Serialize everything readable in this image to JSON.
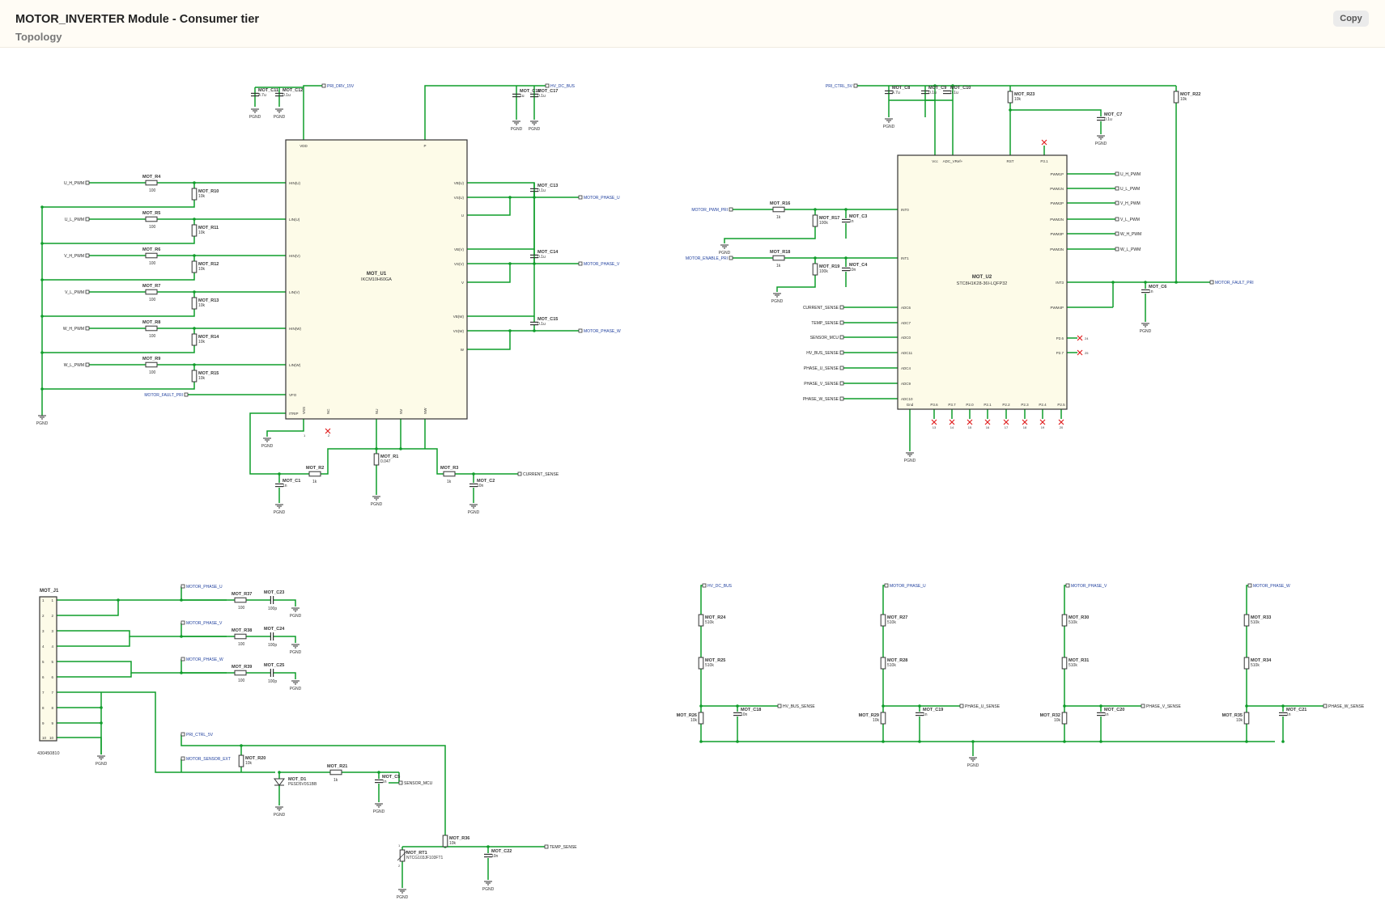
{
  "header": {
    "title": "MOTOR_INVERTER Module - Consumer tier",
    "subtitle": "Topology",
    "copy_label": "Copy"
  },
  "colors": {
    "wire": "#0f9d2a",
    "component": "#333333",
    "ic_fill": "#fdfbe8",
    "net_label": "#1f3f9e",
    "no_connect": "#e02020"
  },
  "gnd_label": "PGND",
  "blocks": {
    "gate_driver": {
      "ic": {
        "ref": "MOT_U1",
        "part": "IKCM10H60GA",
        "left_pins": [
          "HIN(U)",
          "LIN(U)",
          "HIN(V)",
          "LIN(V)",
          "HIN(W)",
          "LIN(W)",
          "VFO",
          "ITRIP"
        ],
        "right_pins": [
          "VB(U)",
          "VS(U)",
          "U",
          "VB(V)",
          "VS(V)",
          "V",
          "VB(W)",
          "VS(W)",
          "W"
        ],
        "top_pins": [
          "VDD",
          "P"
        ],
        "bottom_pins": [
          "VSS",
          "NC",
          "NU",
          "NV",
          "NW"
        ]
      },
      "inputs": [
        {
          "net": "U_H_PWM",
          "r": "MOT_R4",
          "rv": "100",
          "pd": "MOT_R10",
          "pdv": "10k"
        },
        {
          "net": "U_L_PWM",
          "r": "MOT_R5",
          "rv": "100",
          "pd": "MOT_R11",
          "pdv": "10k"
        },
        {
          "net": "V_H_PWM",
          "r": "MOT_R6",
          "rv": "100",
          "pd": "MOT_R12",
          "pdv": "10k"
        },
        {
          "net": "V_L_PWM",
          "r": "MOT_R7",
          "rv": "100",
          "pd": "MOT_R13",
          "pdv": "10k"
        },
        {
          "net": "W_H_PWM",
          "r": "MOT_R8",
          "rv": "100",
          "pd": "MOT_R14",
          "pdv": "10k"
        },
        {
          "net": "W_L_PWM",
          "r": "MOT_R9",
          "rv": "100",
          "pd": "MOT_R15",
          "pdv": "10k"
        }
      ],
      "fault_net": "MOTOR_FAULT_PRI",
      "supply_caps": [
        {
          "ref": "MOT_C11",
          "val": "4.7u"
        },
        {
          "ref": "MOT_C12",
          "val": "0.1u"
        },
        {
          "ref": "MOT_C16",
          "val": "1u"
        },
        {
          "ref": "MOT_C17",
          "val": "0.1u"
        }
      ],
      "supply_nets": [
        "PRI_DRV_15V",
        "HV_DC_BUS"
      ],
      "bootstrap": [
        {
          "ref": "MOT_C13",
          "val": "0.1u",
          "net": "MOTOR_PHASE_U"
        },
        {
          "ref": "MOT_C14",
          "val": "0.1u",
          "net": "MOTOR_PHASE_V"
        },
        {
          "ref": "MOT_C15",
          "val": "0.1u",
          "net": "MOTOR_PHASE_W"
        }
      ],
      "bottom": {
        "c1": {
          "ref": "MOT_C1",
          "val": "1n"
        },
        "r2": {
          "ref": "MOT_R2",
          "val": "1k"
        },
        "r1": {
          "ref": "MOT_R1",
          "val": "0.047"
        },
        "r3": {
          "ref": "MOT_R3",
          "val": "1k"
        },
        "c2": {
          "ref": "MOT_C2",
          "val": "10n"
        },
        "sense_net": "CURRENT_SENSE"
      }
    },
    "mcu": {
      "ic": {
        "ref": "MOT_U2",
        "part": "STC8H1K28-36I-LQFP32",
        "left_pins": [
          "INT0",
          "INT1",
          "ADC6",
          "ADC7",
          "ADC0",
          "ADC11",
          "ADC4",
          "ADC9",
          "ADC10"
        ],
        "right_pins": [
          "PWM1P",
          "PWM1N",
          "PWM2P",
          "PWM2N",
          "PWM3P",
          "PWM3N",
          "INT3",
          "PWM4P",
          "P2.6",
          "P2.7"
        ],
        "top_pins": [
          "Vcc",
          "ADC_VRef+",
          "RST",
          "P3.1"
        ],
        "bottom_pins": [
          "Gnd",
          "P3.6",
          "P3.7",
          "P2.0",
          "P2.1",
          "P2.2",
          "P2.3",
          "P2.4",
          "P2.5"
        ]
      },
      "supply_net": "PRI_CTRL_5V",
      "caps": [
        {
          "ref": "MOT_C8",
          "val": "4.7u"
        },
        {
          "ref": "MOT_C9",
          "val": "0.1u"
        },
        {
          "ref": "MOT_C10",
          "val": "0.1u"
        },
        {
          "ref": "MOT_C7",
          "val": "0.1u"
        }
      ],
      "pullups": [
        {
          "ref": "MOT_R23",
          "val": "10k"
        },
        {
          "ref": "MOT_R22",
          "val": "10k"
        }
      ],
      "pwm_in": {
        "net": "MOTOR_PWM_PRI",
        "r": "MOT_R16",
        "rv": "1k",
        "pd": "MOT_R17",
        "pdv": "100k",
        "c": "MOT_C3",
        "cv": "1n"
      },
      "en_in": {
        "net": "MOTOR_ENABLE_PRI",
        "r": "MOT_R18",
        "rv": "1k",
        "pd": "MOT_R19",
        "pdv": "100k",
        "c": "MOT_C4",
        "cv": "10n"
      },
      "adc_nets": [
        "CURRENT_SENSE",
        "TEMP_SENSE",
        "SENSOR_MCU",
        "HV_BUS_SENSE",
        "PHASE_U_SENSE",
        "PHASE_V_SENSE",
        "PHASE_W_SENSE"
      ],
      "pwm_out_nets": [
        "U_H_PWM",
        "U_L_PWM",
        "V_H_PWM",
        "V_L_PWM",
        "W_H_PWM",
        "W_L_PWM"
      ],
      "fault_net": "MOTOR_FAULT_PRI",
      "fault_cap": {
        "ref": "MOT_C6",
        "val": "1n"
      }
    },
    "connector": {
      "ref": "MOT_J1",
      "part": "430450810",
      "pins": [
        "1",
        "2",
        "3",
        "4",
        "5",
        "6",
        "7",
        "8",
        "9",
        "10"
      ],
      "snubbers": [
        {
          "net": "MOTOR_PHASE_U",
          "r": "MOT_R37",
          "rv": "100",
          "c": "MOT_C23",
          "cv": "100p"
        },
        {
          "net": "MOTOR_PHASE_V",
          "r": "MOT_R38",
          "rv": "100",
          "c": "MOT_C24",
          "cv": "100p"
        },
        {
          "net": "MOTOR_PHASE_W",
          "r": "MOT_R39",
          "rv": "100",
          "c": "MOT_C25",
          "cv": "100p"
        }
      ],
      "sensor": {
        "ctrl_net": "PRI_CTRL_5V",
        "in_net": "MOTOR_SENSOR_EXT",
        "r20": "MOT_R20",
        "r20v": "10k",
        "d1": "MOT_D1",
        "d1v": "PESD5V0S1BB",
        "r21": "MOT_R21",
        "r21v": "1k",
        "c5": "MOT_C5",
        "c5v": "1n",
        "out_net": "SENSOR_MCU"
      },
      "ntc": {
        "r36": "MOT_R36",
        "r36v": "10k",
        "rt1": "MOT_RT1",
        "rt1v": "NTCG103JF103FT1",
        "c22": "MOT_C22",
        "c22v": "10n",
        "out_net": "TEMP_SENSE"
      }
    },
    "dividers": [
      {
        "in_net": "HV_DC_BUS",
        "r_top": "MOT_R24",
        "r_top_v": "510k",
        "r_mid": "MOT_R25",
        "r_mid_v": "510k",
        "r_bot": "MOT_R26",
        "r_bot_v": "10k",
        "c": "MOT_C18",
        "cv": "10n",
        "out_net": "HV_BUS_SENSE"
      },
      {
        "in_net": "MOTOR_PHASE_U",
        "r_top": "MOT_R27",
        "r_top_v": "510k",
        "r_mid": "MOT_R28",
        "r_mid_v": "510k",
        "r_bot": "MOT_R29",
        "r_bot_v": "10k",
        "c": "MOT_C19",
        "cv": "1n",
        "out_net": "PHASE_U_SENSE"
      },
      {
        "in_net": "MOTOR_PHASE_V",
        "r_top": "MOT_R30",
        "r_top_v": "510k",
        "r_mid": "MOT_R31",
        "r_mid_v": "510k",
        "r_bot": "MOT_R32",
        "r_bot_v": "10k",
        "c": "MOT_C20",
        "cv": "1n",
        "out_net": "PHASE_V_SENSE"
      },
      {
        "in_net": "MOTOR_PHASE_W",
        "r_top": "MOT_R33",
        "r_top_v": "510k",
        "r_mid": "MOT_R34",
        "r_mid_v": "510k",
        "r_bot": "MOT_R35",
        "r_bot_v": "10k",
        "c": "MOT_C21",
        "cv": "1n",
        "out_net": "PHASE_W_SENSE"
      }
    ]
  }
}
